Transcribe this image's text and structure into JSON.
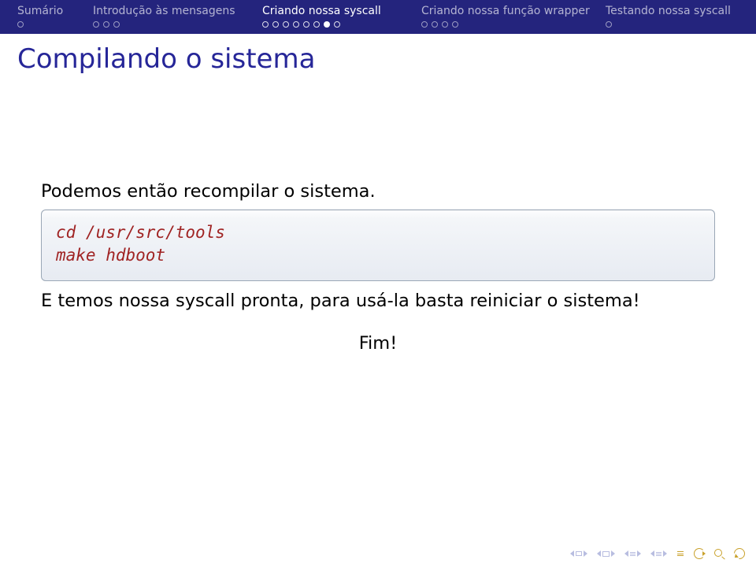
{
  "nav": {
    "sections": [
      {
        "label": "Sumário",
        "slides": 1,
        "currentIndex": -1,
        "current": false
      },
      {
        "label": "Introdução às mensagens",
        "slides": 3,
        "currentIndex": -1,
        "current": false
      },
      {
        "label": "Criando nossa syscall",
        "slides": 8,
        "currentIndex": 6,
        "current": true
      },
      {
        "label": "Criando nossa função wrapper",
        "slides": 4,
        "currentIndex": -1,
        "current": false
      },
      {
        "label": "Testando nossa syscall",
        "slides": 1,
        "currentIndex": -1,
        "current": false
      }
    ]
  },
  "frameTitle": "Compilando o sistema",
  "body": {
    "intro": "Podemos então recompilar o sistema.",
    "codeLine1": "cd /usr/src/tools",
    "codeLine2": "make hdboot",
    "outro": "E temos nossa syscall pronta, para usá-la basta reiniciar o sistema!",
    "fim": "Fim!"
  },
  "chart_data": {
    "type": "table",
    "note": "No chart present; key visible slide content captured as rows.",
    "rows": [
      [
        "frame_title",
        "Compilando o sistema"
      ],
      [
        "text",
        "Podemos então recompilar o sistema."
      ],
      [
        "code",
        "cd /usr/src/tools"
      ],
      [
        "code",
        "make hdboot"
      ],
      [
        "text",
        "E temos nossa syscall pronta, para usá-la basta reiniciar o sistema!"
      ],
      [
        "text_center",
        "Fim!"
      ]
    ]
  }
}
